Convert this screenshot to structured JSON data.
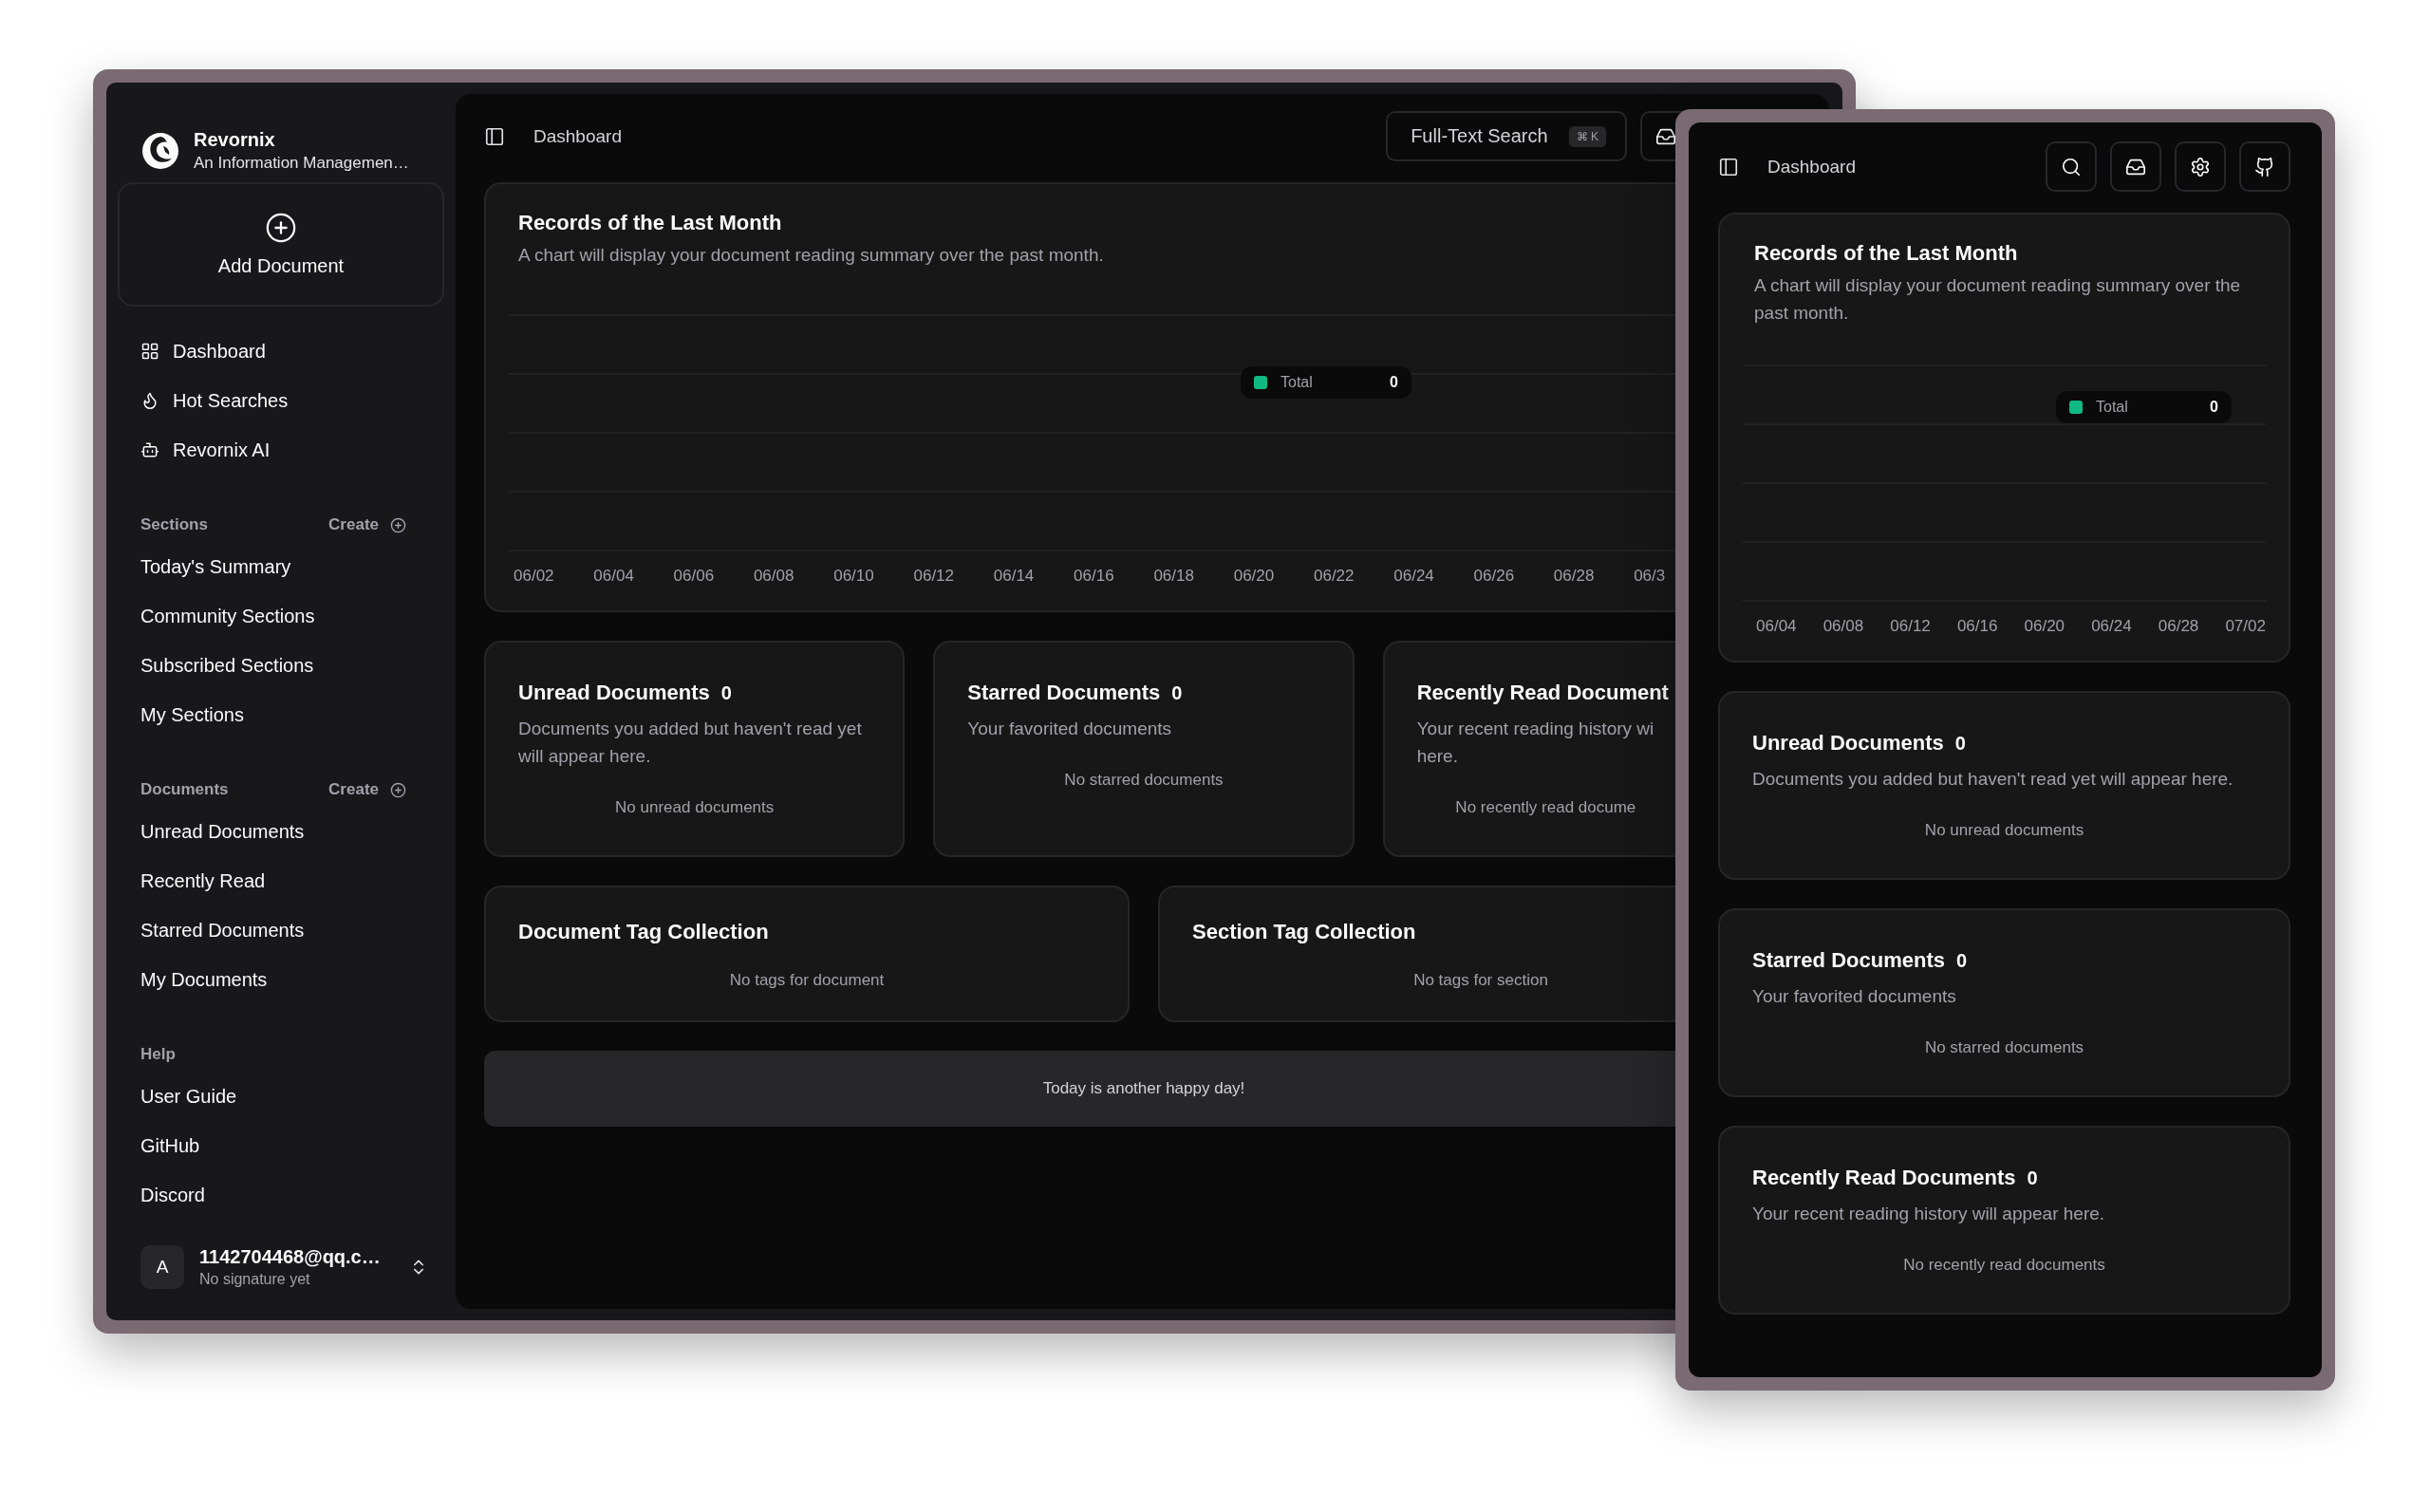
{
  "back_window": {
    "brand": {
      "name": "Revornix",
      "tagline": "An Information Managemen…"
    },
    "add_button": {
      "label": "Add Document"
    },
    "nav": [
      {
        "label": "Dashboard"
      },
      {
        "label": "Hot Searches"
      },
      {
        "label": "Revornix AI"
      }
    ],
    "groups": [
      {
        "title": "Sections",
        "action": "Create",
        "items": [
          {
            "label": "Today's Summary"
          },
          {
            "label": "Community Sections"
          },
          {
            "label": "Subscribed Sections"
          },
          {
            "label": "My Sections"
          }
        ]
      },
      {
        "title": "Documents",
        "action": "Create",
        "items": [
          {
            "label": "Unread Documents"
          },
          {
            "label": "Recently Read"
          },
          {
            "label": "Starred Documents"
          },
          {
            "label": "My Documents"
          }
        ]
      },
      {
        "title": "Help",
        "items": [
          {
            "label": "User Guide"
          },
          {
            "label": "GitHub"
          },
          {
            "label": "Discord"
          }
        ]
      }
    ],
    "user": {
      "avatar": "A",
      "email": "1142704468@qq.c…",
      "signature": "No signature yet"
    },
    "header": {
      "title": "Dashboard",
      "search": {
        "label": "Full-Text Search",
        "shortcut": "⌘ K"
      }
    },
    "chart_card": {
      "title": "Records of the Last Month",
      "subtitle": "A chart will display your document reading summary over the past month.",
      "tooltip": {
        "label": "Total",
        "value": "0",
        "color": "#10b981"
      },
      "x_labels": [
        "06/02",
        "06/04",
        "06/06",
        "06/08",
        "06/10",
        "06/12",
        "06/14",
        "06/16",
        "06/18",
        "06/20",
        "06/22",
        "06/24",
        "06/26",
        "06/28",
        "06/3"
      ]
    },
    "stat_cards": [
      {
        "title": "Unread Documents",
        "count": "0",
        "description": "Documents you added but haven't read yet will appear here.",
        "empty": "No unread documents"
      },
      {
        "title": "Starred Documents",
        "count": "0",
        "description": "Your favorited documents",
        "empty": "No starred documents"
      },
      {
        "title": "Recently Read Document",
        "description": "Your recent reading history wi\nhere.",
        "empty": "No recently read docume"
      }
    ],
    "tag_cards": [
      {
        "title": "Document Tag Collection",
        "empty": "No tags for document"
      },
      {
        "title": "Section Tag Collection",
        "empty": "No tags for section"
      }
    ],
    "banner": "Today is another happy day!"
  },
  "front_window": {
    "header": {
      "title": "Dashboard"
    },
    "chart_card": {
      "title": "Records of the Last Month",
      "subtitle": "A chart will display your document reading summary over the past month.",
      "tooltip": {
        "label": "Total",
        "value": "0",
        "color": "#10b981"
      },
      "x_labels": [
        "06/04",
        "06/08",
        "06/12",
        "06/16",
        "06/20",
        "06/24",
        "06/28",
        "07/02"
      ]
    },
    "stat_cards": [
      {
        "title": "Unread Documents",
        "count": "0",
        "description": "Documents you added but haven't read yet will appear here.",
        "empty": "No unread documents"
      },
      {
        "title": "Starred Documents",
        "count": "0",
        "description": "Your favorited documents",
        "empty": "No starred documents"
      },
      {
        "title": "Recently Read Documents",
        "count": "0",
        "description": "Your recent reading history will appear here.",
        "empty": "No recently read documents"
      }
    ]
  }
}
